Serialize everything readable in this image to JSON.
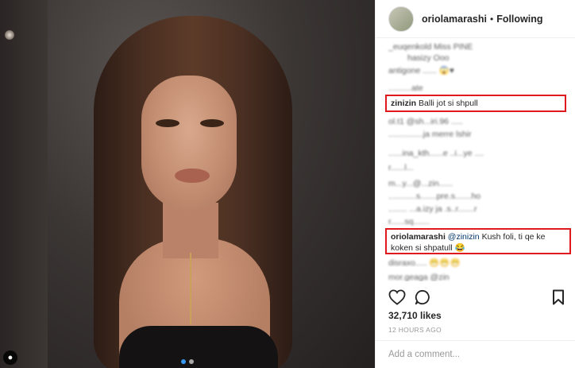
{
  "post": {
    "carousel_dots": 2,
    "active_dot": 0
  },
  "header": {
    "username": "oriolamarashi",
    "separator": "•",
    "follow_status": "Following"
  },
  "comments": {
    "blurred": [
      "_euqenkold Miss PINE",
      "hasizy Ooo",
      "antigone ...... 😱♥",
      "..........ate",
      "ol.t1 @sh...iri.96 .....",
      "...............ja merre lshir",
      "......ina_kth......e ..i...ye ....",
      "r......l...",
      "m...y...@...zin......",
      "............s.......pre.s.......ho",
      "........ ...a.izy ja .s..r.......r",
      "r......sq.......",
      "disraxo..... 😁😁😁",
      "mor.geaga @zin"
    ],
    "highlight1": {
      "username": "zinizin",
      "text": "Balli jot si shpull"
    },
    "highlight2": {
      "username": "oriolamarashi",
      "mention": "@zinizin",
      "text": "Kush foli, ti qe ke koken si shpatull 😂"
    }
  },
  "actions": {
    "like_icon": "heart-outline-icon",
    "comment_icon": "comment-bubble-icon",
    "save_icon": "bookmark-icon"
  },
  "likes": "32,710 likes",
  "timestamp": "12 HOURS AGO",
  "add_comment": {
    "placeholder": "Add a comment..."
  },
  "colors": {
    "highlight_border": "#e0191f",
    "mention": "#003569",
    "active_dot": "#3897f0",
    "muted": "#999999"
  }
}
